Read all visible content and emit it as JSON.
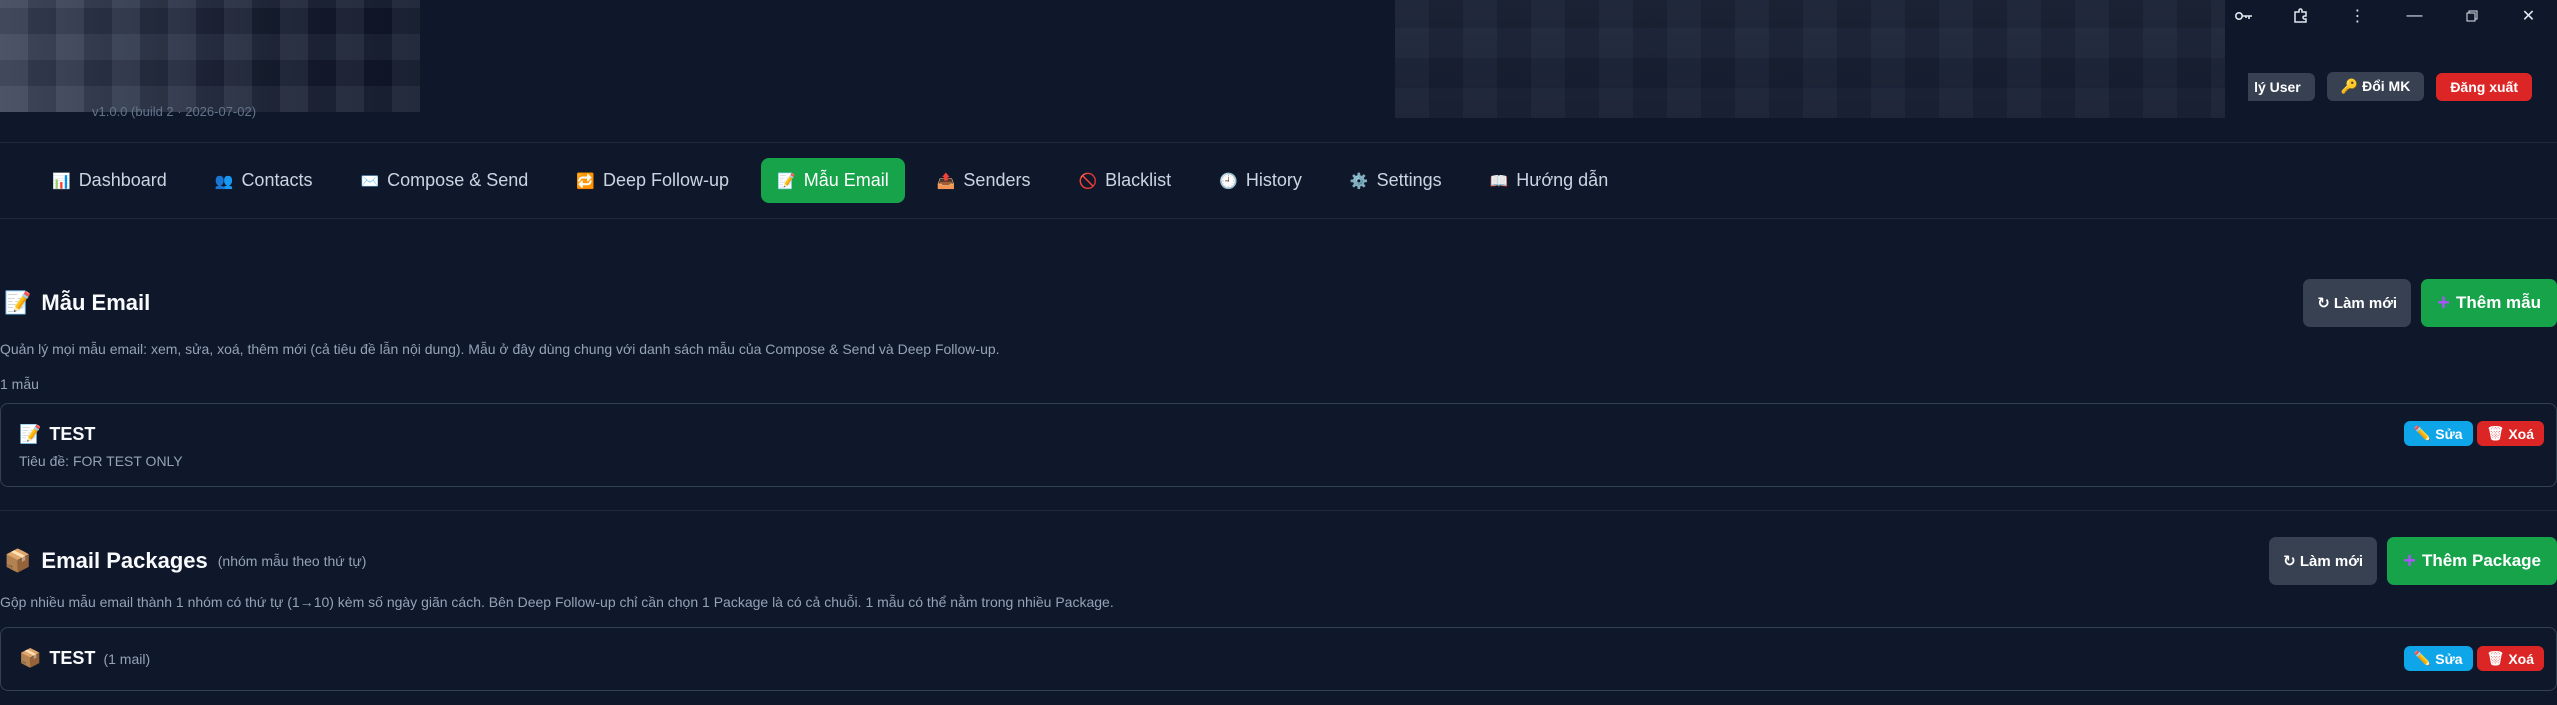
{
  "header": {
    "version_text": "v1.0.0 (build 2 · 2026-07-02)",
    "window_controls": [
      "key-icon",
      "extension-icon",
      "more-icon",
      "minimize-icon",
      "restore-icon",
      "close-icon"
    ],
    "buttons": {
      "manage_users": "lý User",
      "change_password": "🔑 Đổi MK",
      "logout": "Đăng xuất"
    }
  },
  "nav": {
    "tabs": [
      {
        "icon": "📊",
        "label": "Dashboard",
        "active": false
      },
      {
        "icon": "👥",
        "label": "Contacts",
        "active": false
      },
      {
        "icon": "✉️",
        "label": "Compose & Send",
        "active": false
      },
      {
        "icon": "🔁",
        "label": "Deep Follow-up",
        "active": false
      },
      {
        "icon": "📝",
        "label": "Mẫu Email",
        "active": true
      },
      {
        "icon": "📤",
        "label": "Senders",
        "active": false
      },
      {
        "icon": "🚫",
        "label": "Blacklist",
        "active": false
      },
      {
        "icon": "🕘",
        "label": "History",
        "active": false
      },
      {
        "icon": "⚙️",
        "label": "Settings",
        "active": false
      },
      {
        "icon": "📖",
        "label": "Hướng dẫn",
        "active": false
      }
    ]
  },
  "templates": {
    "icon": "📝",
    "title": "Mẫu Email",
    "refresh_label": "↻ Làm mới",
    "add_label": "Thêm mẫu",
    "description": "Quản lý mọi mẫu email: xem, sửa, xoá, thêm mới (cả tiêu đề lẫn nội dung). Mẫu ở đây dùng chung với danh sách mẫu của Compose & Send và Deep Follow-up.",
    "count_text": "1 mẫu",
    "items": [
      {
        "icon": "📝",
        "name": "TEST",
        "subject": "Tiêu đề: FOR TEST ONLY",
        "edit_label": "Sửa",
        "delete_label": "Xoá"
      }
    ]
  },
  "packages": {
    "icon": "📦",
    "title": "Email Packages",
    "subtitle": "(nhóm mẫu theo thứ tự)",
    "refresh_label": "↻ Làm mới",
    "add_label": "Thêm Package",
    "description": "Gộp nhiều mẫu email thành 1 nhóm có thứ tự (1→10) kèm số ngày giãn cách. Bên Deep Follow-up chỉ cần chọn 1 Package là có cả chuỗi. 1 mẫu có thể nằm trong nhiều Package.",
    "items": [
      {
        "icon": "📦",
        "name": "TEST",
        "meta": "(1 mail)",
        "edit_label": "Sửa",
        "delete_label": "Xoá"
      }
    ]
  },
  "colors": {
    "background": "#0f172a",
    "accent_green": "#16a34a",
    "danger_red": "#dc2626",
    "info_blue": "#0ea5e9"
  }
}
